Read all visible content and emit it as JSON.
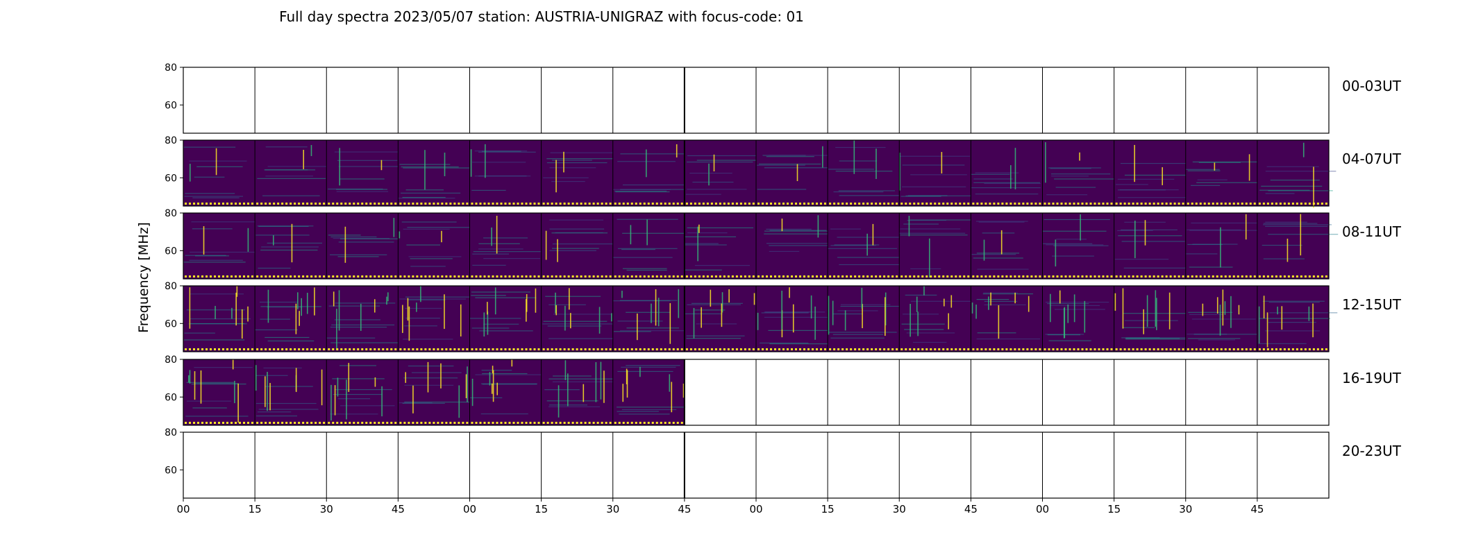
{
  "title": "Full day spectra 2023/05/07 station: AUSTRIA-UNIGRAZ with focus-code: 01",
  "ylabel": "Frequency [MHz]",
  "chart_data": {
    "type": "heatmap",
    "title": "Full day spectra 2023/05/07 station: AUSTRIA-UNIGRAZ with focus-code: 01",
    "ylabel": "Frequency [MHz]",
    "xlabel": "",
    "ylim": [
      45,
      80
    ],
    "y_ticks": [
      "80",
      "60"
    ],
    "x_ticks": [
      "00",
      "15",
      "30",
      "45",
      "00",
      "15",
      "30",
      "45",
      "00",
      "15",
      "30",
      "45",
      "00",
      "15",
      "30",
      "45"
    ],
    "colormap": {
      "low": "#440154",
      "mid": "#21918c",
      "high": "#fde725"
    },
    "rows": [
      {
        "label": "00-03UT",
        "filled_segments": 0
      },
      {
        "label": "04-07UT",
        "filled_segments": 16
      },
      {
        "label": "08-11UT",
        "filled_segments": 16
      },
      {
        "label": "12-15UT",
        "filled_segments": 16
      },
      {
        "label": "16-19UT",
        "filled_segments": 7
      },
      {
        "label": "20-23UT",
        "filled_segments": 0
      }
    ]
  }
}
